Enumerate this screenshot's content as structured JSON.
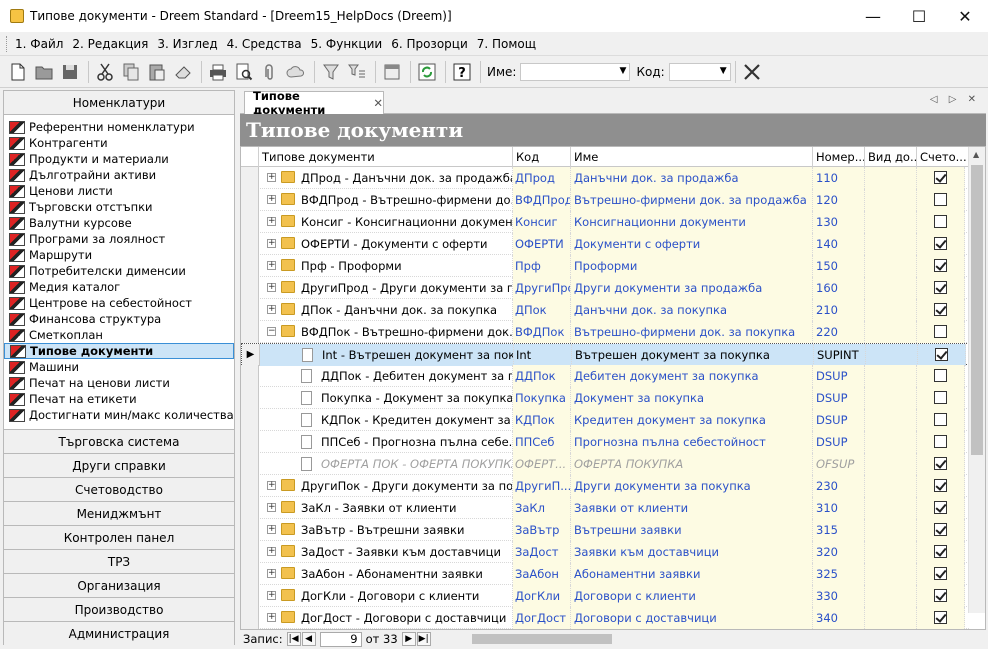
{
  "window": {
    "title": "Типове документи - Dreem Standard - [Dreem15_HelpDocs (Dreem)]"
  },
  "menu": [
    "1. Файл",
    "2. Редакция",
    "3. Изглед",
    "4. Средства",
    "5. Функции",
    "6. Прозорци",
    "7. Помощ"
  ],
  "toolbar": {
    "name_label": "Име:",
    "code_label": "Код:"
  },
  "sidebar": {
    "header": "Номенклатури",
    "items": [
      "Референтни номенклатури",
      "Контрагенти",
      "Продукти и материали",
      "Дълготрайни активи",
      "Ценови листи",
      "Търговски отстъпки",
      "Валутни курсове",
      "Програми за лоялност",
      "Маршрути",
      "Потребителски дименсии",
      "Медия каталог",
      "Центрове на себестойност",
      "Финансова структура",
      "Сметкоплан",
      "Типове документи",
      "Машини",
      "Печат на ценови листи",
      "Печат на етикети",
      "Достигнати мин/макс количества"
    ],
    "selected_index": 14,
    "sections": [
      "Търговска система",
      "Други справки",
      "Счетоводство",
      "Мениджмънт",
      "Контролен панел",
      "ТРЗ",
      "Организация",
      "Производство",
      "Администрация"
    ]
  },
  "tab": {
    "label": "Типове документи"
  },
  "page_title": "Типове документи",
  "grid": {
    "columns": [
      "Типове документи",
      "Код",
      "Име",
      "Номер...",
      "Вид до...",
      "Счето..."
    ],
    "rows": [
      {
        "name": "ДПрод - Данъчни док. за продажба",
        "kod": "ДПрод",
        "ime": "Данъчни док. за продажба",
        "nom": "110",
        "chk": true,
        "level": 0,
        "type": "folder"
      },
      {
        "name": "ВФДПрод - Вътрешно-фирмени до...",
        "kod": "ВФДПрод",
        "ime": "Вътрешно-фирмени док. за продажба",
        "nom": "120",
        "chk": false,
        "level": 0,
        "type": "folder"
      },
      {
        "name": "Консиг - Консигнационни документи",
        "kod": "Консиг",
        "ime": "Консигнационни документи",
        "nom": "130",
        "chk": false,
        "level": 0,
        "type": "folder"
      },
      {
        "name": "ОФЕРТИ - Документи с оферти",
        "kod": "ОФЕРТИ",
        "ime": "Документи с оферти",
        "nom": "140",
        "chk": true,
        "level": 0,
        "type": "folder"
      },
      {
        "name": "Прф - Проформи",
        "kod": "Прф",
        "ime": "Проформи",
        "nom": "150",
        "chk": true,
        "level": 0,
        "type": "folder"
      },
      {
        "name": "ДругиПрод - Други документи за п...",
        "kod": "ДругиПрод",
        "ime": "Други документи за продажба",
        "nom": "160",
        "chk": true,
        "level": 0,
        "type": "folder"
      },
      {
        "name": "ДПок - Данъчни док. за покупка",
        "kod": "ДПок",
        "ime": "Данъчни док. за покупка",
        "nom": "210",
        "chk": true,
        "level": 0,
        "type": "folder"
      },
      {
        "name": "ВФДПок - Вътрешно-фирмени док. ...",
        "kod": "ВФДПок",
        "ime": "Вътрешно-фирмени док. за покупка",
        "nom": "220",
        "chk": false,
        "level": 0,
        "type": "folder",
        "expanded": true
      },
      {
        "name": "Int - Вътрешен документ за поку...",
        "kod": "Int",
        "ime": "Вътрешен документ за покупка",
        "nom": "SUPINT",
        "chk": true,
        "level": 1,
        "type": "doc",
        "selected": true
      },
      {
        "name": "ДДПок - Дебитен документ за п...",
        "kod": "ДДПок",
        "ime": "Дебитен документ за покупка",
        "nom": "DSUP",
        "chk": false,
        "level": 1,
        "type": "doc"
      },
      {
        "name": "Покупка - Документ за покупка",
        "kod": "Покупка",
        "ime": "Документ за покупка",
        "nom": "DSUP",
        "chk": false,
        "level": 1,
        "type": "doc"
      },
      {
        "name": "КДПок - Кредитен документ за п...",
        "kod": "КДПок",
        "ime": "Кредитен документ за покупка",
        "nom": "DSUP",
        "chk": false,
        "level": 1,
        "type": "doc"
      },
      {
        "name": "ППСеб - Прогнозна пълна себе...",
        "kod": "ППСеб",
        "ime": "Прогнозна пълна себестойност",
        "nom": "DSUP",
        "chk": false,
        "level": 1,
        "type": "doc"
      },
      {
        "name": "ОФЕРТА ПОК - ОФЕРТА ПОКУПКА",
        "kod": "ОФЕРТ...",
        "ime": "ОФЕРТА ПОКУПКА",
        "nom": "OFSUP",
        "chk": true,
        "level": 1,
        "type": "doc",
        "disabled": true
      },
      {
        "name": "ДругиПок - Други документи за пок...",
        "kod": "ДругиП...",
        "ime": "Други документи за покупка",
        "nom": "230",
        "chk": true,
        "level": 0,
        "type": "folder"
      },
      {
        "name": "ЗаКл - Заявки от клиенти",
        "kod": "ЗаКл",
        "ime": "Заявки от клиенти",
        "nom": "310",
        "chk": true,
        "level": 0,
        "type": "folder"
      },
      {
        "name": "ЗаВътр - Вътрешни заявки",
        "kod": "ЗаВътр",
        "ime": "Вътрешни заявки",
        "nom": "315",
        "chk": true,
        "level": 0,
        "type": "folder"
      },
      {
        "name": "ЗаДост - Заявки към доставчици",
        "kod": "ЗаДост",
        "ime": "Заявки към доставчици",
        "nom": "320",
        "chk": true,
        "level": 0,
        "type": "folder"
      },
      {
        "name": "ЗаАбон - Абонаментни заявки",
        "kod": "ЗаАбон",
        "ime": "Абонаментни заявки",
        "nom": "325",
        "chk": true,
        "level": 0,
        "type": "folder"
      },
      {
        "name": "ДогКли - Договори с клиенти",
        "kod": "ДогКли",
        "ime": "Договори с клиенти",
        "nom": "330",
        "chk": true,
        "level": 0,
        "type": "folder"
      },
      {
        "name": "ДогДост - Договори с доставчици",
        "kod": "ДогДост",
        "ime": "Договори с доставчици",
        "nom": "340",
        "chk": true,
        "level": 0,
        "type": "folder"
      }
    ]
  },
  "navigator": {
    "label": "Запис:",
    "current": "9",
    "total_text": "от 33"
  }
}
